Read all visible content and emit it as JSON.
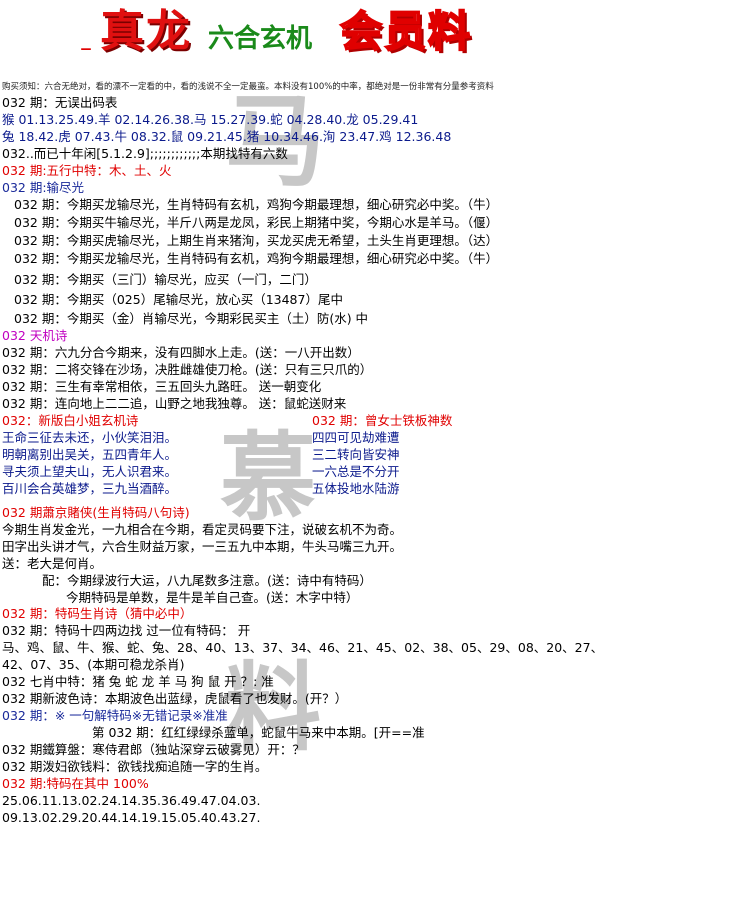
{
  "header": {
    "dash": "–",
    "t1": "真龙",
    "t2": "六合玄机",
    "t3": "会员料"
  },
  "watermark": {
    "w1": "马",
    "w2": "慕",
    "w3": "料"
  },
  "disclaimer": "购买须知：六合无绝对，看的漂不一定看的中，看的浅说不全一定最蛮。本料没有100%的中率，都绝对是一份非常有分量参考资料",
  "lines": {
    "l01": "032 期：无误出码表",
    "l02": "猴 01.13.25.49.羊 02.14.26.38.马 15.27.39.蛇 04.28.40.龙 05.29.41",
    "l03": "兔 18.42.虎 07.43.牛 08.32.鼠 09.21.45.猪 10.34.46.洵 23.47.鸡 12.36.48",
    "l04": "032..而已十年闲[5.1.2.9];;;;;;;;;;;;本期找特有六数",
    "l05": "032 期:五行中特：木、土、火",
    "l06": "032 期:输尽光",
    "l07": "032 期：今期买龙输尽光，生肖特码有玄机，鸡狗今期最理想，细心研究必中奖。（牛）",
    "l08": "032 期：今期买牛输尽光，半斤八两是龙凤，彩民上期猪中奖，今期心水是羊马。（偃）",
    "l09": "032 期：今期买虎输尽光，上期生肖来猪洵，买龙买虎无希望，土头生肖更理想。（达）",
    "l10": "032 期：今期买龙输尽光，生肖特码有玄机，鸡狗今期最理想，细心研究必中奖。（牛）",
    "l11": "032 期：今期买（三门）输尽光，应买（一门，二门）",
    "l12": "032 期：今期买（025）尾输尽光，放心买（13487）尾中",
    "l13": "032 期：今期买（金）肖输尽光，今期彩民买主（土）防(水) 中",
    "l14": "032 天机诗",
    "l15": "032 期：六九分合今期来，没有四脚水上走。(送：一八开出数）",
    "l16": "032 期：二将交锋在沙场，决胜雌雄使刀枪。(送：只有三只爪的）",
    "l17": "032 期：三生有幸常相依，三五回头九路旺。 送一朝变化",
    "l18": "032 期：连向地上二二追，山野之地我独尊。 送：鼠蛇送财来",
    "l19": "032：新版白小姐玄机诗",
    "l20": "王命三征去未还，小伙笑泪泪。",
    "l21": "明朝离别出吴关，五四青年人。",
    "l22": "寻夫须上望夫山，无人识君来。",
    "l23": "百川会合英雄梦，三九当酒醉。",
    "r19": "032 期：曾女士铁板神数",
    "r20": "四四可见劫难遭",
    "r21": "三二转向皆安神",
    "r22": "一六总是不分开",
    "r23": "五体投地水陆游",
    "l24": "032 期蕭京賭侠(生肖特码八句诗)",
    "l25": "今期生肖发金光，一九相合在今期，看定灵码要下注，说破玄机不为奇。",
    "l26": "田字出头讲才气，六合生财益万家，一三五九中本期，牛头马嘴三九开。",
    "l27": "送：老大是何肖。",
    "l28": "配：今期绿波行大运，八九尾数多注意。(送：诗中有特码）",
    "l29": "今期特码是单数，是牛是羊自己查。(送：木字中特）",
    "l30": "032 期：特码生肖诗（猜中必中）",
    "l31": "032 期：特码十四两边找   过一位有特码：  开",
    "l32": "马、鸡、鼠、牛、猴、蛇、兔、28、40、13、37、34、46、21、45、02、38、05、29、08、20、27、",
    "l33": "42、07、35、(本期可稳龙杀肖)",
    "l34": "032 七肖中特：猪 兔 蛇 龙 羊 马 狗 鼠 开 ？: 准",
    "l35": "032 期新波色诗：本期波色出蓝绿，虎鼠看了也发财。(开？）",
    "l36": "032 期：※ 一句解特码※无错记录※准准",
    "l37": "第 032 期：红红绿绿杀蓝单，蛇鼠牛马来中本期。[开==准",
    "l38": "032 期鐵算盤：寒侍君郎（独站深穿云破雾见）开：？",
    "l39": "032 期泼妇欲钱料：欲钱找痴追随一字的生肖。",
    "l40": "032 期:特码在其中 100%",
    "l41": "25.06.11.13.02.24.14.35.36.49.47.04.03.",
    "l42": "09.13.02.29.20.44.14.19.15.05.40.43.27."
  }
}
